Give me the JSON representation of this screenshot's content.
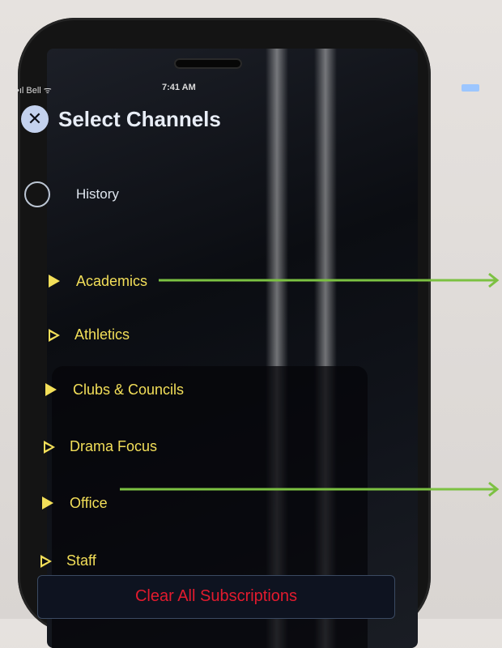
{
  "status_bar": {
    "carrier": "•ıl Bell ᯤ",
    "time": "7:41 AM"
  },
  "header": {
    "title": "Select Channels",
    "close_icon": "close-icon"
  },
  "history": {
    "label": "History",
    "icon": "radio-circle-icon"
  },
  "channels": [
    {
      "label": "Academics",
      "icon": "triangle-filled-icon"
    },
    {
      "label": "Athletics",
      "icon": "triangle-outline-icon"
    },
    {
      "label": "Clubs & Councils",
      "icon": "triangle-filled-icon"
    },
    {
      "label": "Drama Focus",
      "icon": "triangle-outline-icon"
    },
    {
      "label": "Office",
      "icon": "triangle-filled-icon"
    },
    {
      "label": "Staff",
      "icon": "triangle-outline-icon"
    }
  ],
  "footer": {
    "clear_label": "Clear All Subscriptions"
  },
  "colors": {
    "accent": "#f3df59",
    "danger": "#e21b2e",
    "annotation": "#7cc142"
  }
}
